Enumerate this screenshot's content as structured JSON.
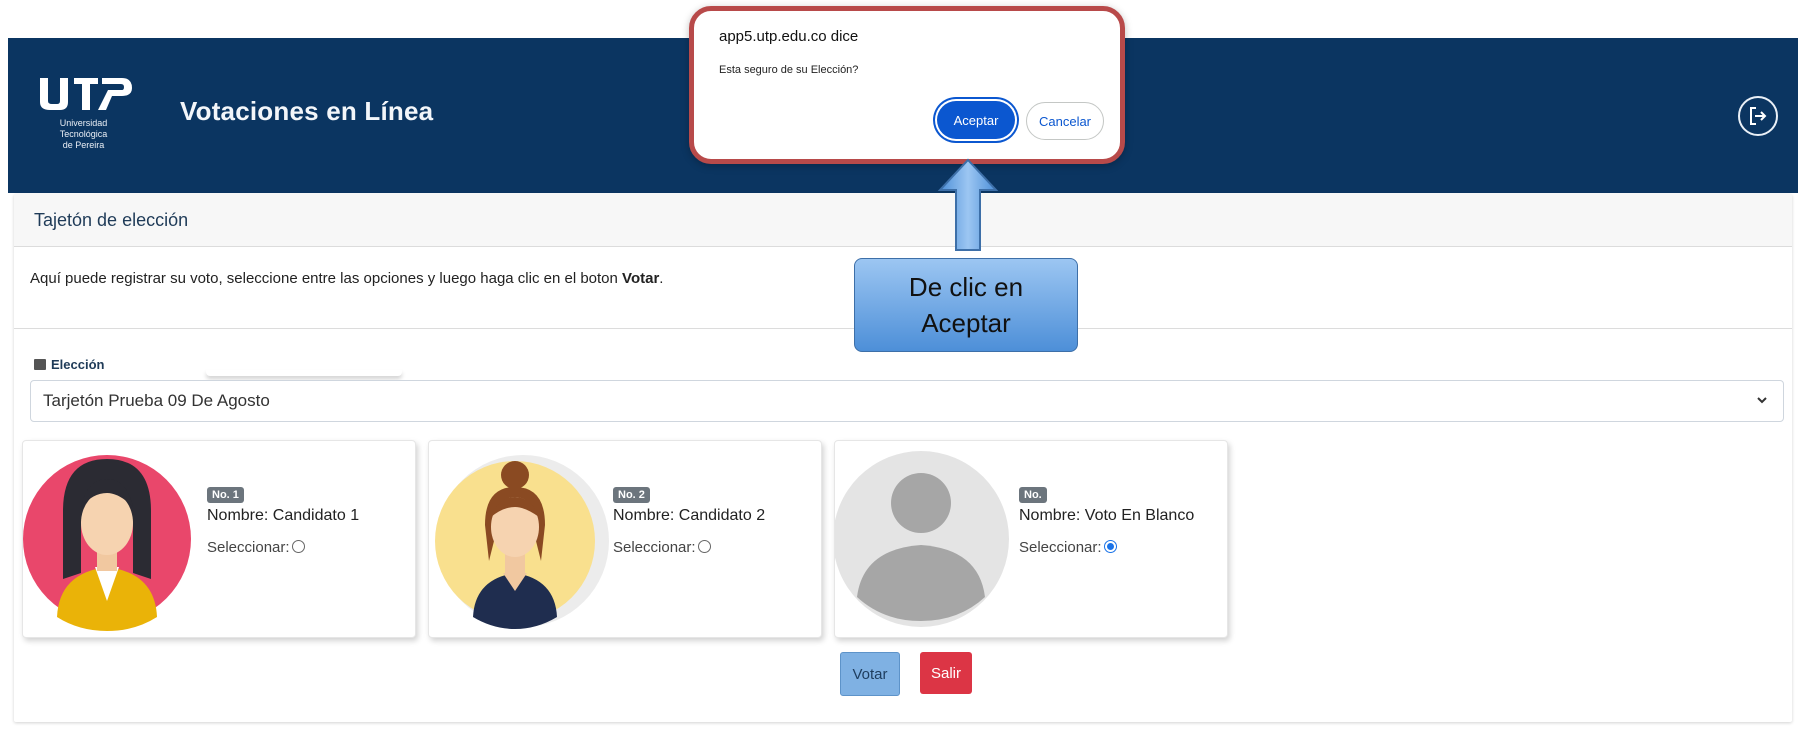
{
  "header": {
    "logo_text": "UTP",
    "logo_subtitle_line1": "Universidad Tecnológica",
    "logo_subtitle_line2": "de Pereira",
    "title": "Votaciones en Línea",
    "logout_icon": "logout-icon"
  },
  "card": {
    "title": "Tajetón de elección",
    "intro_text": "Aquí puede registrar su voto, seleccione entre las opciones y luego haga clic en el boton ",
    "intro_bold": "Votar",
    "intro_end": ".",
    "election_label": "Elección",
    "election_value": "Tarjetón Prueba 09 De Agosto"
  },
  "candidates": [
    {
      "badge": "No. 1",
      "name": "Nombre: Candidato 1",
      "select_label": "Seleccionar:",
      "selected": false
    },
    {
      "badge": "No. 2",
      "name": "Nombre: Candidato 2",
      "select_label": "Seleccionar:",
      "selected": false
    },
    {
      "badge": "No.",
      "name": "Nombre: Voto En Blanco",
      "select_label": "Seleccionar:",
      "selected": true
    }
  ],
  "actions": {
    "vote": "Votar",
    "exit": "Salir"
  },
  "dialog": {
    "origin": "app5.utp.edu.co dice",
    "message": "Esta seguro de su Elección?",
    "accept": "Aceptar",
    "cancel": "Cancelar"
  },
  "callout": {
    "line1": "De clic en",
    "line2": "Aceptar"
  },
  "colors": {
    "header_bg": "#0b3561",
    "dialog_border": "#b84a4a",
    "accept_btn": "#0b57d0",
    "exit_btn": "#dc3545",
    "vote_btn": "#7fb1e3"
  }
}
